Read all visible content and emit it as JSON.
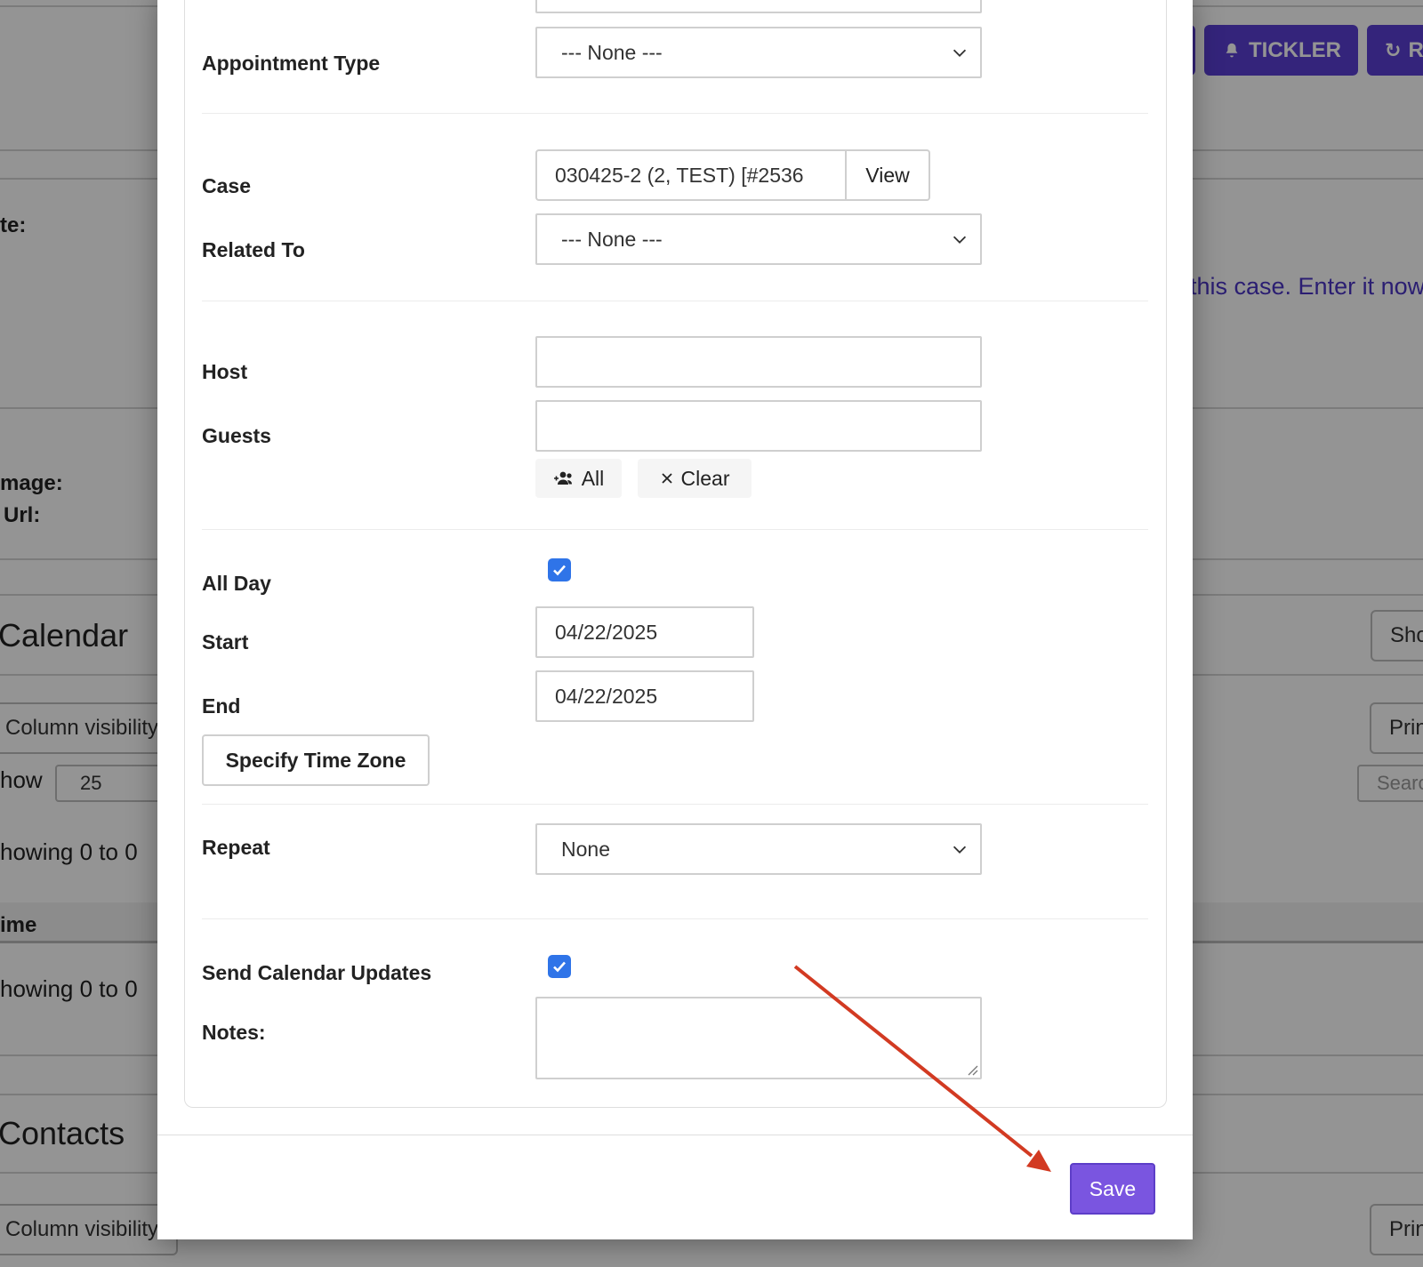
{
  "background": {
    "header_buttons": [
      {
        "label": "TICKLER",
        "icon": "bell-icon"
      },
      {
        "label": "R",
        "icon": "refresh-icon"
      }
    ],
    "labels": {
      "date_partial": "te:",
      "image_partial": "mage:",
      "url_partial": "Url:"
    },
    "notice_partial": "this case. Enter it now",
    "calendar_section": {
      "title_partial": "Calendar",
      "column_visibility": "Column visibility",
      "show_label_partial": "how",
      "show_value": "25",
      "showing_top_partial": "howing 0 to 0",
      "time_header_partial": "ime",
      "showing_bottom_partial": "howing 0 to 0",
      "show_button_partial": "Sho",
      "print_button_partial": "Prin",
      "search_placeholder_partial": "Searc"
    },
    "contacts_section": {
      "title_partial": "Contacts",
      "column_visibility": "Column visibility",
      "print_button_partial": "Prin"
    },
    "colors": {
      "accent": "#5b3fd4",
      "overlay": "rgba(0,0,0,0.42)"
    }
  },
  "modal": {
    "fields": {
      "appointment_type": {
        "label": "Appointment Type",
        "value": "--- None ---"
      },
      "case": {
        "label": "Case",
        "value": "030425-2 (2, TEST) [#2536",
        "view_button": "View"
      },
      "related_to": {
        "label": "Related To",
        "value": "--- None ---"
      },
      "host": {
        "label": "Host",
        "value": ""
      },
      "guests": {
        "label": "Guests",
        "value": "",
        "all_button": "All",
        "clear_button": "Clear"
      },
      "all_day": {
        "label": "All Day",
        "checked": true
      },
      "start": {
        "label": "Start",
        "value": "04/22/2025"
      },
      "end": {
        "label": "End",
        "value": "04/22/2025"
      },
      "time_zone_button": "Specify Time Zone",
      "repeat": {
        "label": "Repeat",
        "value": "None"
      },
      "send_calendar_updates": {
        "label": "Send Calendar Updates",
        "checked": true
      },
      "notes": {
        "label": "Notes:",
        "value": ""
      }
    },
    "footer": {
      "save_button": "Save"
    },
    "colors": {
      "save": "#7a55e0",
      "checkbox": "#2f74e8",
      "annotation_arrow": "#d23a22"
    }
  }
}
